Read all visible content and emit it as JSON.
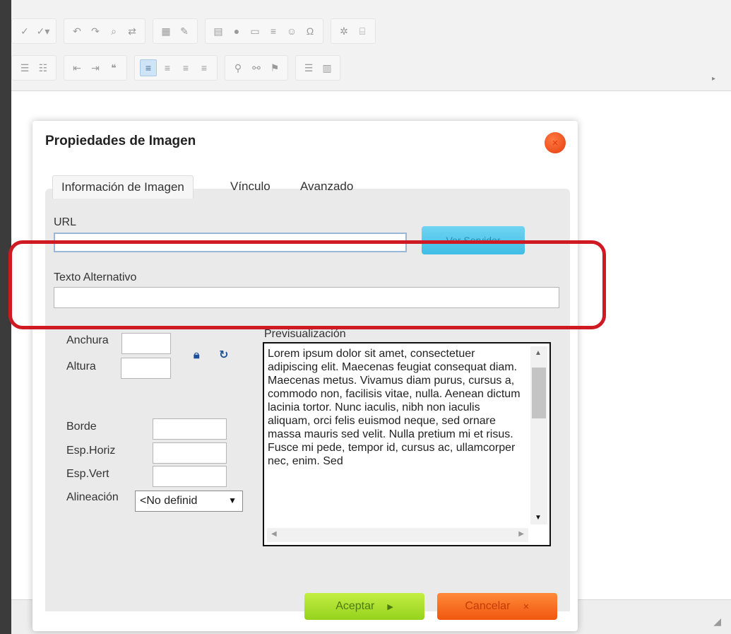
{
  "dialog": {
    "title": "Propiedades de Imagen",
    "tabs": [
      {
        "label": "Información de Imagen",
        "active": true
      },
      {
        "label": "Vínculo",
        "active": false
      },
      {
        "label": "Avanzado",
        "active": false
      }
    ],
    "url_label": "URL",
    "url_value": "",
    "browse_button_label": "Ver Servidor",
    "alt_text_label": "Texto Alternativo",
    "alt_text_value": "",
    "width_label": "Anchura",
    "width_value": "",
    "height_label": "Altura",
    "height_value": "",
    "border_label": "Borde",
    "border_value": "",
    "hspace_label": "Esp.Horiz",
    "hspace_value": "",
    "vspace_label": "Esp.Vert",
    "vspace_value": "",
    "align_label": "Alineación",
    "align_value": "<No definid",
    "preview_label": "Previsualización",
    "preview_text": "Lorem ipsum dolor sit amet, consectetuer adipiscing elit. Maecenas feugiat consequat diam. Maecenas metus. Vivamus diam purus, cursus a, commodo non, facilisis vitae, nulla. Aenean dictum lacinia tortor. Nunc iaculis, nibh non iaculis aliquam, orci felis euismod neque, sed ornare massa mauris sed velit. Nulla pretium mi et risus. Fusce mi pede, tempor id, cursus ac, ullamcorper nec, enim. Sed",
    "ok_label": "Aceptar",
    "cancel_label": "Cancelar"
  },
  "icons": {
    "close": "close-icon",
    "lock": "lock-icon",
    "reset": "refresh-icon",
    "dropdown": "chevron-down-icon",
    "scroll_up": "arrow-up-icon",
    "scroll_down": "arrow-down-icon",
    "button_arrow": "chevron-right-icon"
  },
  "colors": {
    "highlight": "#cf1a23",
    "ok_button": "#a6dc2c",
    "cancel_button": "#f46a1e",
    "browse_button": "#4cc6ec",
    "close_button": "#e8471a"
  }
}
